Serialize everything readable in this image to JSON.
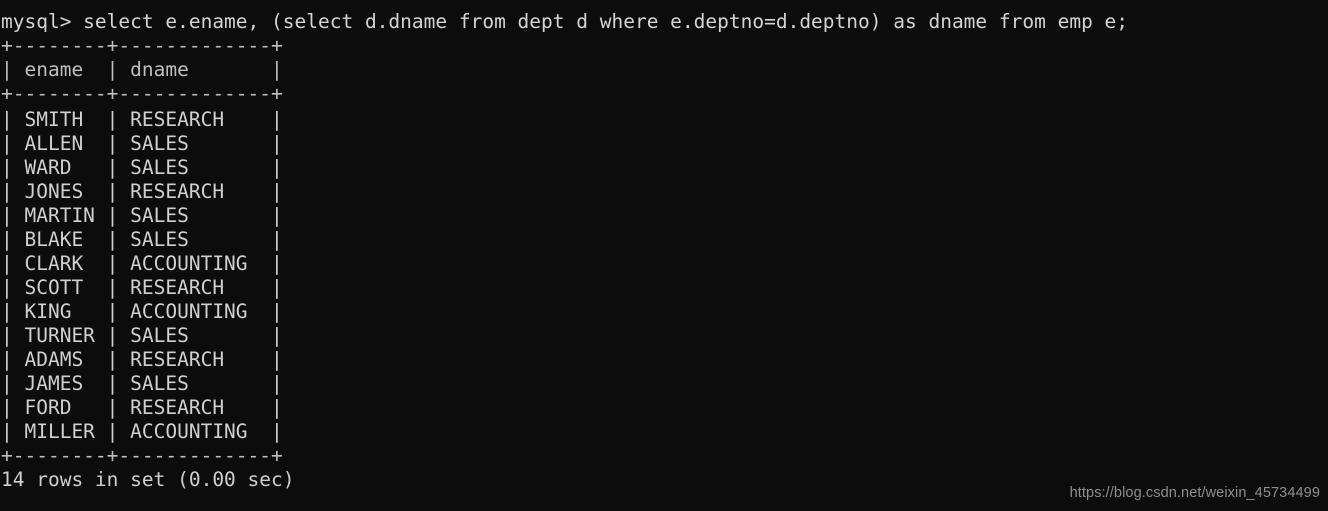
{
  "terminal": {
    "prompt": "mysql>",
    "command": "select e.ename, (select d.dname from dept d where e.deptno=d.deptno) as dname from emp e;",
    "command_line": "mysql> select e.ename, (select d.dname from dept d where e.deptno=d.deptno) as dname from emp e;",
    "border_top": "+--------+-------------+",
    "header_line": "| ename  | dname       |",
    "border_mid": "+--------+-------------+",
    "border_bottom": "+--------+-------------+",
    "status_line": "14 rows in set (0.00 sec)",
    "columns": [
      "ename",
      "dname"
    ],
    "rows": [
      {
        "line": "| SMITH  | RESEARCH    |",
        "ename": "SMITH",
        "dname": "RESEARCH"
      },
      {
        "line": "| ALLEN  | SALES       |",
        "ename": "ALLEN",
        "dname": "SALES"
      },
      {
        "line": "| WARD   | SALES       |",
        "ename": "WARD",
        "dname": "SALES"
      },
      {
        "line": "| JONES  | RESEARCH    |",
        "ename": "JONES",
        "dname": "RESEARCH"
      },
      {
        "line": "| MARTIN | SALES       |",
        "ename": "MARTIN",
        "dname": "SALES"
      },
      {
        "line": "| BLAKE  | SALES       |",
        "ename": "BLAKE",
        "dname": "SALES"
      },
      {
        "line": "| CLARK  | ACCOUNTING  |",
        "ename": "CLARK",
        "dname": "ACCOUNTING"
      },
      {
        "line": "| SCOTT  | RESEARCH    |",
        "ename": "SCOTT",
        "dname": "RESEARCH"
      },
      {
        "line": "| KING   | ACCOUNTING  |",
        "ename": "KING",
        "dname": "ACCOUNTING"
      },
      {
        "line": "| TURNER | SALES       |",
        "ename": "TURNER",
        "dname": "SALES"
      },
      {
        "line": "| ADAMS  | RESEARCH    |",
        "ename": "ADAMS",
        "dname": "RESEARCH"
      },
      {
        "line": "| JAMES  | SALES       |",
        "ename": "JAMES",
        "dname": "SALES"
      },
      {
        "line": "| FORD   | RESEARCH    |",
        "ename": "FORD",
        "dname": "RESEARCH"
      },
      {
        "line": "| MILLER | ACCOUNTING  |",
        "ename": "MILLER",
        "dname": "ACCOUNTING"
      }
    ],
    "row_count_text": "14 rows",
    "elapsed_text": "(0.00 sec)",
    "colors": {
      "background": "#0c0c0c",
      "foreground": "#cfcfcf",
      "watermark": "#8f8f8f"
    }
  },
  "watermark": {
    "text": "https://blog.csdn.net/weixin_45734499"
  }
}
